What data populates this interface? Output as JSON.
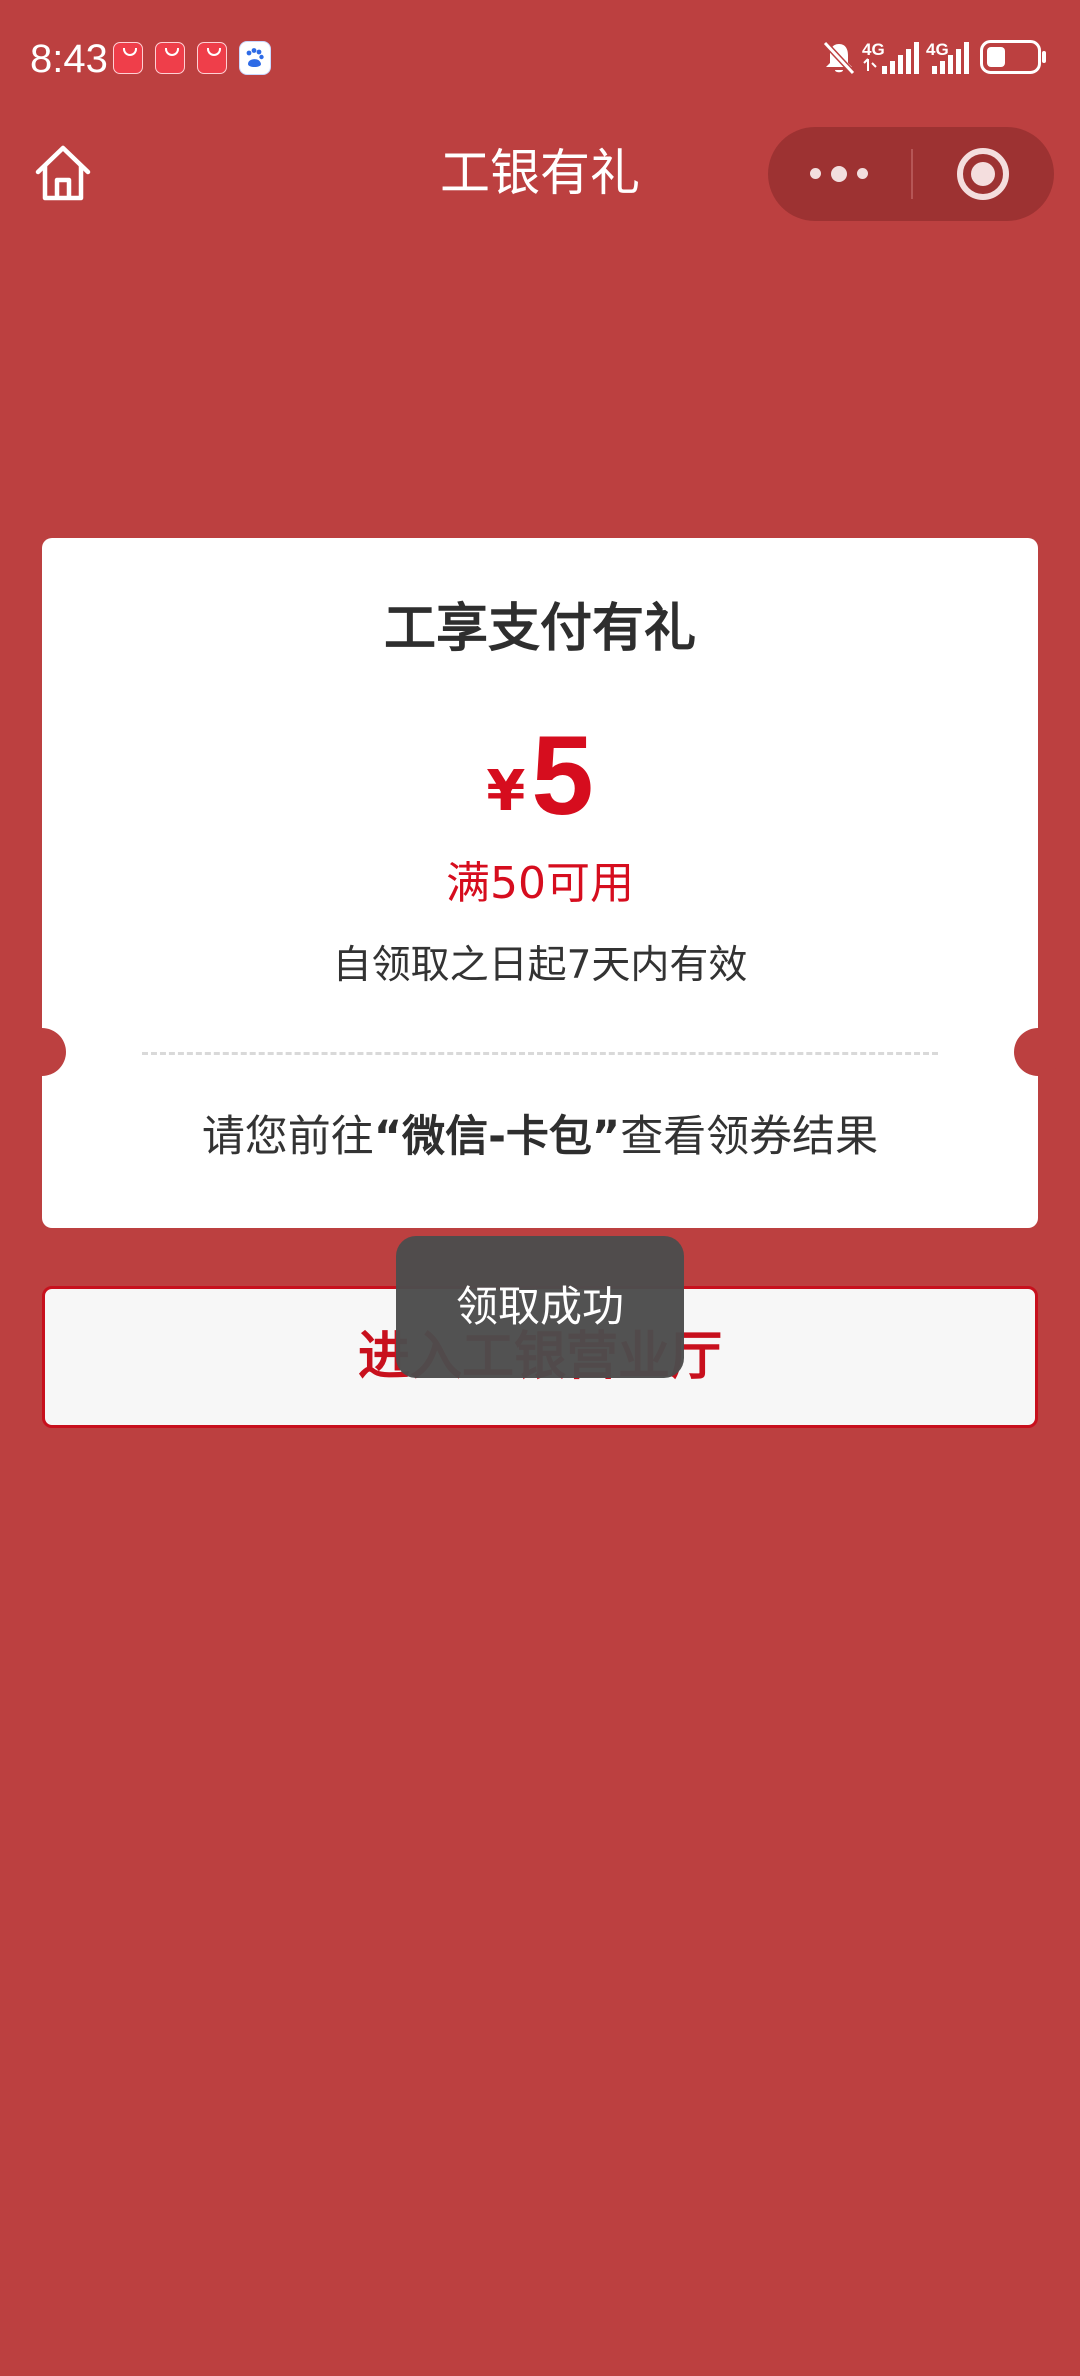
{
  "status_bar": {
    "time": "8:43",
    "network_1": "4G",
    "network_2": "4G",
    "icons": [
      "app-notification-icon",
      "app-notification-icon",
      "app-notification-icon",
      "baidu-icon",
      "bell-off-icon",
      "signal-icon",
      "signal-icon",
      "battery-icon"
    ],
    "battery_level": 0.3
  },
  "nav": {
    "title": "工银有礼",
    "home_icon": "home-icon",
    "more_icon": "more-icon",
    "close_icon": "target-icon"
  },
  "coupon": {
    "title": "工享支付有礼",
    "currency": "¥",
    "amount": "5",
    "condition": "满50可用",
    "validity": "自领取之日起7天内有效",
    "hint_before": "请您前往",
    "hint_highlight": "“微信-卡包”",
    "hint_after": "查看领券结果"
  },
  "button": {
    "label": "进入工银营业厅"
  },
  "toast": {
    "message": "领取成功"
  },
  "colors": {
    "background": "#bc4040",
    "accent_red": "#d60d1e",
    "capsule": "#9d3232",
    "toast": "#4c4c4c"
  }
}
